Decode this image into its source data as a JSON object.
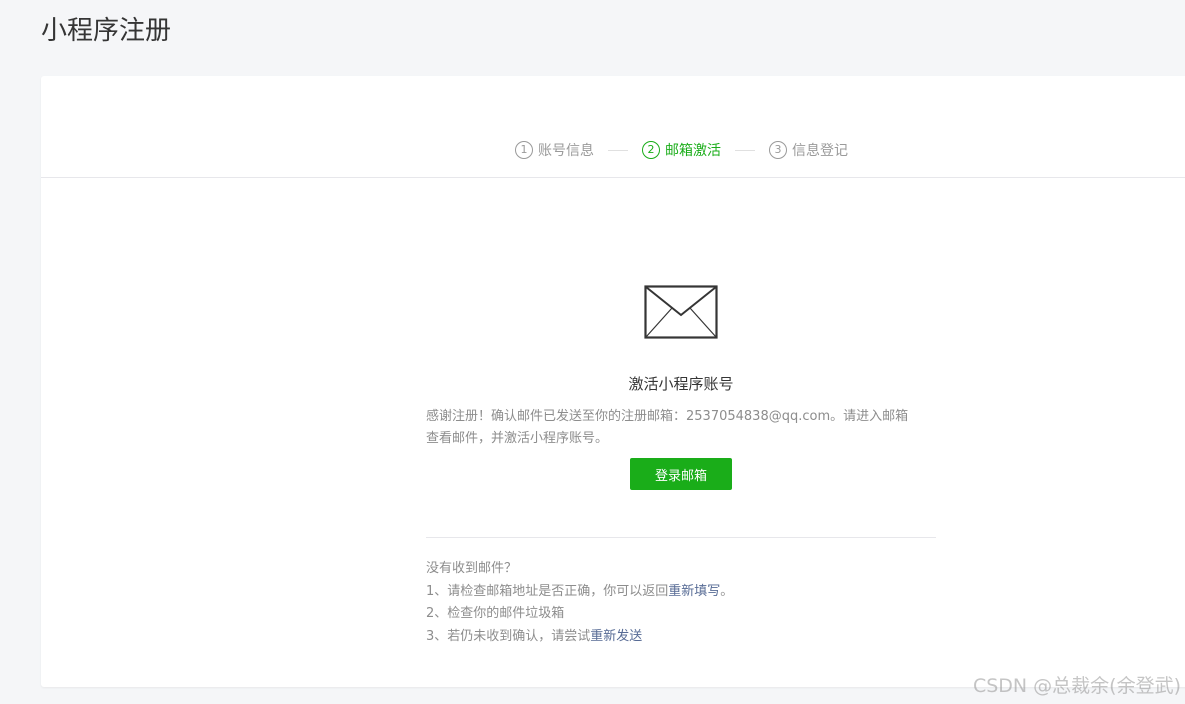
{
  "page": {
    "title": "小程序注册"
  },
  "steps": [
    {
      "num": "1",
      "label": "账号信息",
      "active": false
    },
    {
      "num": "2",
      "label": "邮箱激活",
      "active": true
    },
    {
      "num": "3",
      "label": "信息登记",
      "active": false
    }
  ],
  "activation": {
    "icon": "envelope-icon",
    "heading": "激活小程序账号",
    "desc_line1": "感谢注册！确认邮件已发送至你的注册邮箱：2537054838@qq.com。请进入邮箱",
    "desc_line2": "查看邮件，并激活小程序账号。",
    "button_label": "登录邮箱"
  },
  "help": {
    "title": "没有收到邮件？",
    "item1_prefix": "1、请检查邮箱地址是否正确，你可以返回",
    "item1_link": "重新填写",
    "item1_suffix": "。",
    "item2": "2、检查你的邮件垃圾箱",
    "item3_prefix": "3、若仍未收到确认，请尝试",
    "item3_link": "重新发送"
  },
  "watermark": "CSDN @总裁余(余登武)",
  "colors": {
    "accent": "#1aad19",
    "link": "#576b95",
    "muted": "#8d8d8d"
  }
}
